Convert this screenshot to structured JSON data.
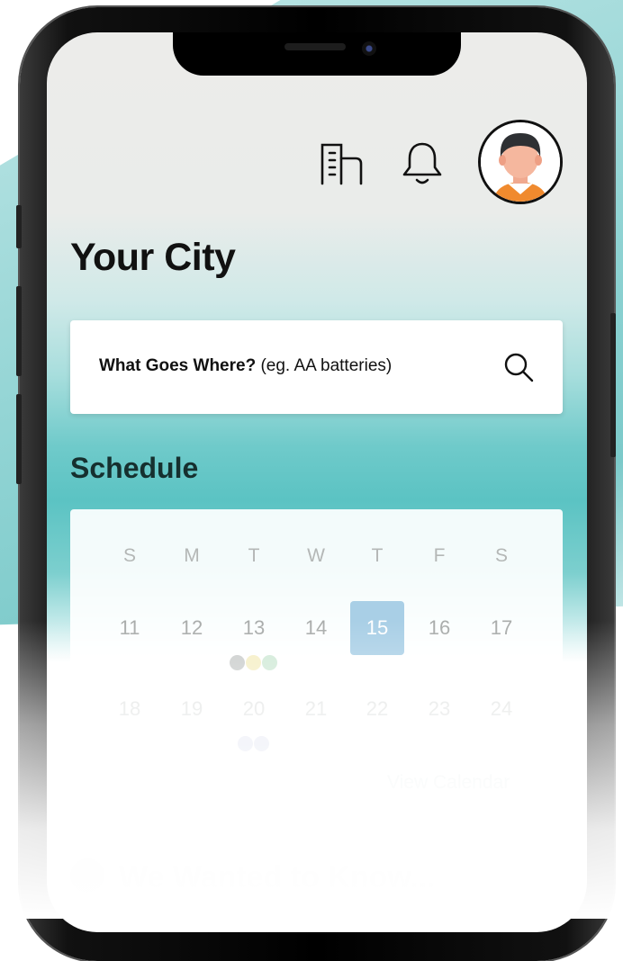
{
  "header": {
    "icons": [
      "building-icon",
      "bell-icon",
      "avatar"
    ]
  },
  "page": {
    "title": "Your City"
  },
  "search": {
    "label_bold": "What Goes Where?",
    "label_hint": "(eg. AA batteries)",
    "icon": "search-icon"
  },
  "schedule": {
    "title": "Schedule",
    "weekdays": [
      "S",
      "M",
      "T",
      "W",
      "T",
      "F",
      "S"
    ],
    "week1": [
      "11",
      "12",
      "13",
      "14",
      "15",
      "16",
      "17"
    ],
    "week2": [
      "18",
      "19",
      "20",
      "21",
      "22",
      "23",
      "24"
    ],
    "selected_day": "15",
    "view_calendar": "View Calendar",
    "dot_colors": {
      "gray": "#c9cccb",
      "yellow": "#f5eec3",
      "green": "#cfe9d6",
      "blue": "#e3e6f3"
    },
    "accent": "#a9cfe6"
  },
  "faq": {
    "title": "We Wanted to Know..."
  }
}
